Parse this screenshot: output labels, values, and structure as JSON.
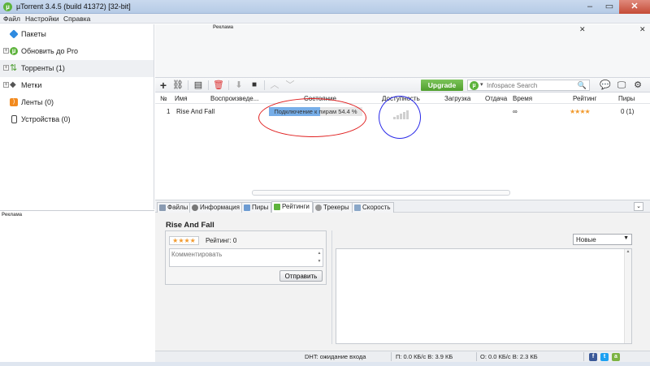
{
  "window": {
    "title": "µTorrent 3.4.5  (build 41372) [32-bit]",
    "logo": "µ",
    "min": "–",
    "max": "▭",
    "close": "✕"
  },
  "menu": [
    "Файл",
    "Настройки",
    "Справка"
  ],
  "sidebar": {
    "items": [
      {
        "label": "Пакеты",
        "icon": "bundle-icon"
      },
      {
        "label": "Обновить до Pro",
        "icon": "utorrent-icon"
      },
      {
        "label": "Торренты (1)",
        "icon": "torrents-icon"
      },
      {
        "label": "Метки",
        "icon": "tag-icon"
      },
      {
        "label": "Ленты (0)",
        "icon": "rss-icon"
      },
      {
        "label": "Устройства (0)",
        "icon": "device-icon"
      }
    ],
    "ad_label": "Реклама"
  },
  "top_ad": {
    "label": "Реклама"
  },
  "toolbar": {
    "upgrade_label": "Upgrade",
    "search_placeholder": "Infospace Search"
  },
  "list": {
    "columns": [
      "№",
      "Имя",
      "Воспроизведе...",
      "Состояние",
      "Доступность",
      "Загрузка",
      "Отдача",
      "Время",
      "Рейтинг",
      "Пиры"
    ],
    "rows": [
      {
        "num": "1",
        "name": "Rise And Fall",
        "status": "Подключение к пирам 54.4 %",
        "progress": 0.544,
        "download": "",
        "upload": "",
        "time": "∞",
        "rating": "★★★★",
        "peers": "0 (1)"
      }
    ]
  },
  "details": {
    "tabs": [
      "Файлы",
      "Информация",
      "Пиры",
      "Рейтинги",
      "Трекеры",
      "Скорость"
    ],
    "active_tab": "Рейтинги",
    "torrent_name": "Rise And Fall",
    "rating_stars": "★★★★",
    "rating_label": "Рейтинг: 0",
    "comment_placeholder": "Комментировать",
    "send_label": "Отправить",
    "sort_value": "Новые"
  },
  "status": {
    "dht": "DHT: ожидание входа",
    "down": "П: 0.0 КБ/с В: 3.9 КБ",
    "up": "О: 0.0 КБ/с В: 2.3 КБ"
  },
  "colors": {
    "accent_green": "#5db33c",
    "progress_fill": "#77aee8",
    "annotation_red": "#e02020",
    "annotation_blue": "#2a2ae8",
    "star": "#f29a2e"
  }
}
